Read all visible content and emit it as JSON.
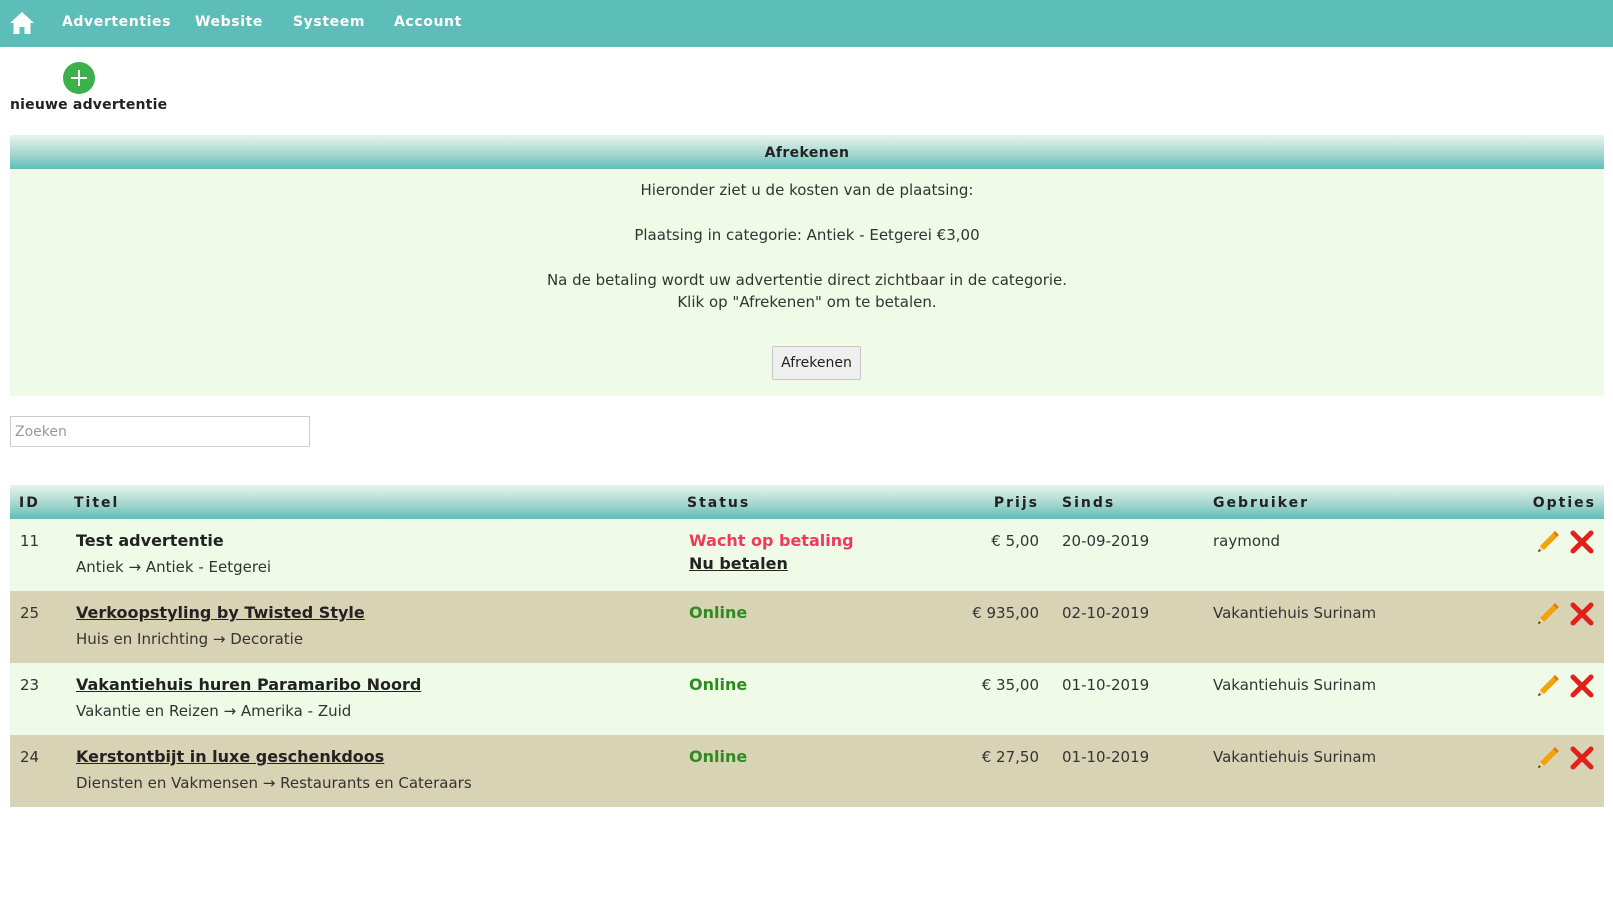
{
  "nav": {
    "home_icon": "home-icon",
    "items": [
      {
        "label": "Advertenties"
      },
      {
        "label": "Website"
      },
      {
        "label": "Systeem"
      },
      {
        "label": "Account"
      }
    ]
  },
  "new_ad": {
    "label": "nieuwe advertentie",
    "icon": "plus-circle-icon"
  },
  "checkout": {
    "title": "Afrekenen",
    "intro": "Hieronder ziet u de kosten van de plaatsing:",
    "placement": "Plaatsing in categorie: Antiek - Eetgerei €3,00",
    "info_line1": "Na de betaling wordt uw advertentie direct zichtbaar in de categorie.",
    "info_line2": "Klik op \"Afrekenen\" om te betalen.",
    "button_label": "Afrekenen"
  },
  "search": {
    "placeholder": "Zoeken",
    "value": ""
  },
  "table": {
    "headers": {
      "id": "ID",
      "title": "Titel",
      "status": "Status",
      "price": "Prijs",
      "since": "Sinds",
      "user": "Gebruiker",
      "options": "Opties"
    },
    "rows": [
      {
        "id": "11",
        "title": "Test advertentie",
        "category": "Antiek → Antiek - Eetgerei",
        "status": "Wacht op betaling",
        "pay_link": "Nu betalen",
        "price": "€ 5,00",
        "since": "20-09-2019",
        "user": "raymond"
      },
      {
        "id": "25",
        "title": "Verkoopstyling by Twisted Style",
        "category": "Huis en Inrichting → Decoratie",
        "status": "Online",
        "price": "€ 935,00",
        "since": "02-10-2019",
        "user": "Vakantiehuis Surinam"
      },
      {
        "id": "23",
        "title": "Vakantiehuis huren Paramaribo Noord",
        "category": "Vakantie en Reizen → Amerika - Zuid",
        "status": "Online",
        "price": "€ 35,00",
        "since": "01-10-2019",
        "user": "Vakantiehuis Surinam"
      },
      {
        "id": "24",
        "title": "Kerstontbijt in luxe geschenkdoos",
        "category": "Diensten en Vakmensen → Restaurants en Cateraars",
        "status": "Online",
        "price": "€ 27,50",
        "since": "01-10-2019",
        "user": "Vakantiehuis Surinam"
      }
    ],
    "row_icons": {
      "edit": "pencil-icon",
      "delete": "delete-x-icon"
    }
  },
  "colors": {
    "nav_bg": "#5dbdb9",
    "panel_bg": "#effbe6",
    "row_alt_bg": "#d8d3b4",
    "online": "#2e8b1f",
    "waiting": "#f0395d",
    "plus_green": "#3cb04a",
    "delete_red": "#e0201b",
    "edit_orange": "#f2a20c"
  }
}
